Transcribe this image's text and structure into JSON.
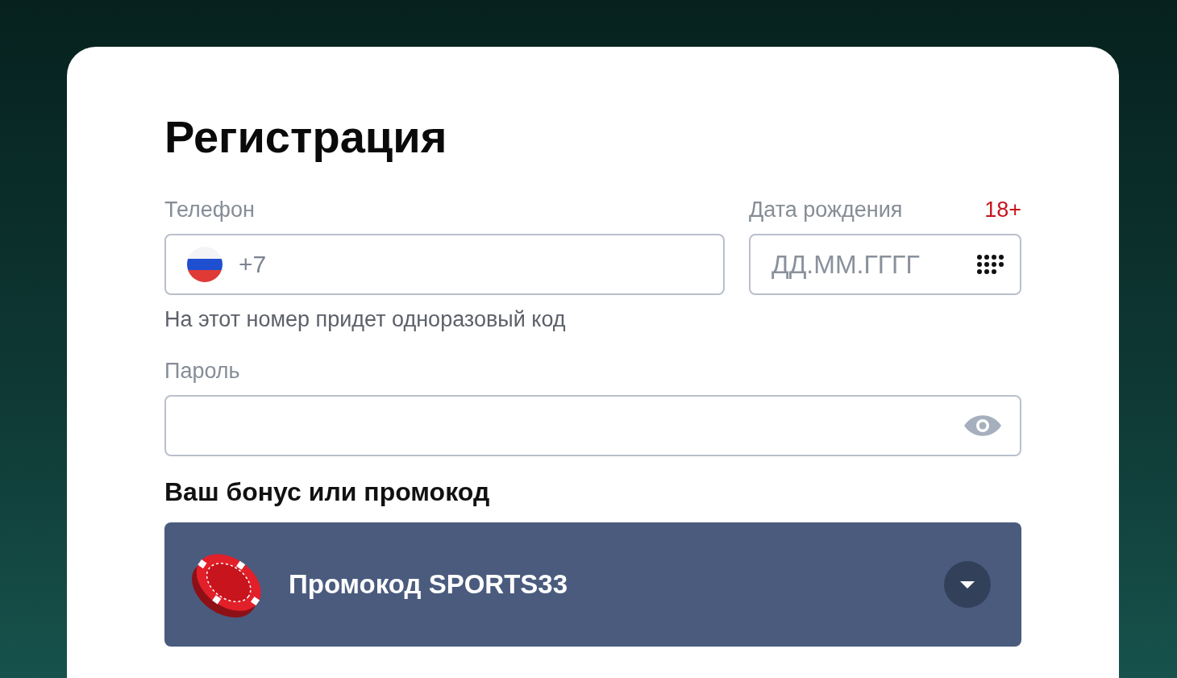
{
  "title": "Регистрация",
  "phone": {
    "label": "Телефон",
    "prefix": "+7",
    "hint": "На этот номер придет одноразовый код"
  },
  "birth_date": {
    "label": "Дата рождения",
    "age_badge": "18+",
    "placeholder": "ДД.ММ.ГГГГ"
  },
  "password": {
    "label": "Пароль"
  },
  "bonus": {
    "heading": "Ваш бонус или промокод",
    "selected_option": "Промокод SPORTS33"
  }
}
